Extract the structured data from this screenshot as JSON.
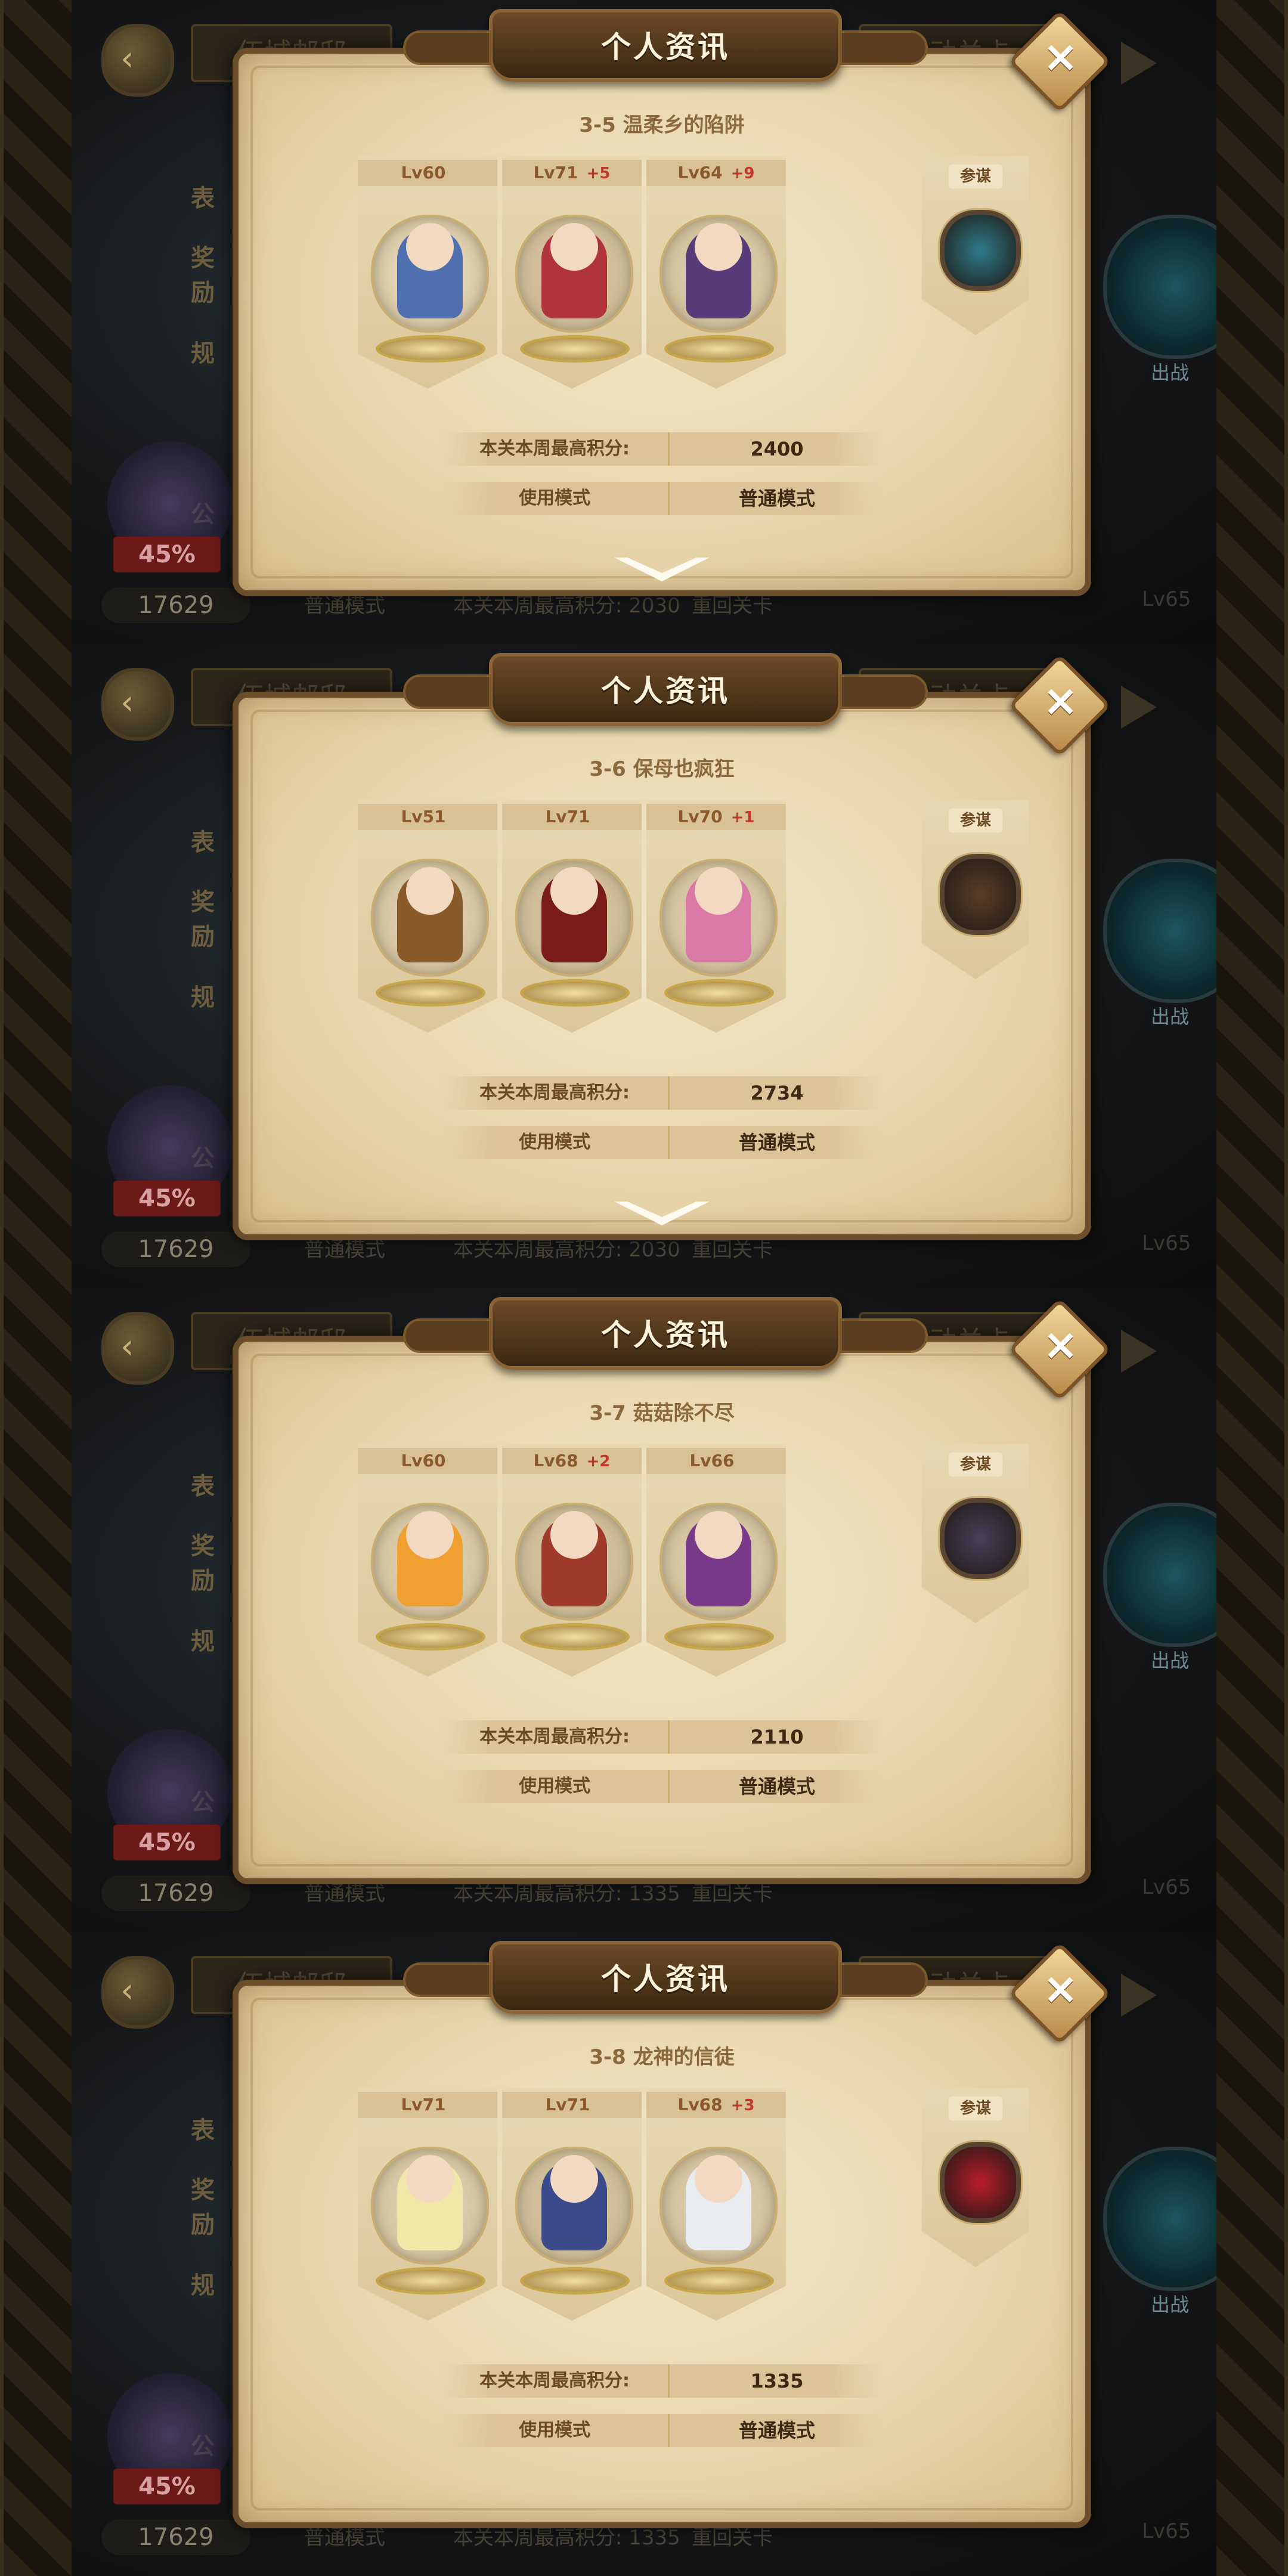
{
  "dialog_title": "个人资讯",
  "close_icon": "×",
  "background": {
    "back_icon": "‹",
    "tab_left": "伍城邮邸",
    "tab_right": "活动关卡",
    "side_items": [
      "表",
      "奖励",
      "规",
      "公"
    ],
    "percent": "45%",
    "player_score": "17629",
    "mode_text": "普通模式",
    "next_button": "重回关卡",
    "sortie_label": "出战",
    "level_hint": "Lv65"
  },
  "stat_labels": {
    "best_score": "本关本周最高积分:",
    "mode": "使用模式",
    "helper": "参谋"
  },
  "panels": [
    {
      "stage": "3-5 温柔乡的陷阱",
      "bg_score_line": "本关本周最高积分: 2030",
      "heroes": [
        {
          "lv": "Lv60",
          "plus": ""
        },
        {
          "lv": "Lv71",
          "plus": "+5"
        },
        {
          "lv": "Lv64",
          "plus": "+9"
        }
      ],
      "score": "2400",
      "mode": "普通模式",
      "show_arrow": true
    },
    {
      "stage": "3-6 保母也疯狂",
      "bg_score_line": "本关本周最高积分: 2030",
      "heroes": [
        {
          "lv": "Lv51",
          "plus": ""
        },
        {
          "lv": "Lv71",
          "plus": ""
        },
        {
          "lv": "Lv70",
          "plus": "+1"
        }
      ],
      "score": "2734",
      "mode": "普通模式",
      "show_arrow": true
    },
    {
      "stage": "3-7 菇菇除不尽",
      "bg_score_line": "本关本周最高积分: 1335",
      "heroes": [
        {
          "lv": "Lv60",
          "plus": ""
        },
        {
          "lv": "Lv68",
          "plus": "+2"
        },
        {
          "lv": "Lv66",
          "plus": ""
        }
      ],
      "score": "2110",
      "mode": "普通模式",
      "show_arrow": false
    },
    {
      "stage": "3-8 龙神的信徒",
      "bg_score_line": "本关本周最高积分: 1335",
      "heroes": [
        {
          "lv": "Lv71",
          "plus": ""
        },
        {
          "lv": "Lv71",
          "plus": ""
        },
        {
          "lv": "Lv68",
          "plus": "+3"
        }
      ],
      "score": "1335",
      "mode": "普通模式",
      "show_arrow": false
    }
  ],
  "colors": {
    "parchment": "#efe0bb",
    "frame": "#6a4e2b",
    "title_text": "#fff4de",
    "plus_red": "#c0392b",
    "portrait_palettes": [
      [
        "#f5ead3",
        "#4f6fb0"
      ],
      [
        "#d9c8a6",
        "#b0333e"
      ],
      [
        "#e6d6b9",
        "#5a3b7a"
      ],
      [
        "#eadcc0",
        "#8a5b2a"
      ],
      [
        "#d9c8a6",
        "#7a1c1c"
      ],
      [
        "#e6d6b9",
        "#d97aa6"
      ],
      [
        "#eadcc0",
        "#f0a030"
      ],
      [
        "#d9c8a6",
        "#a03a2a"
      ],
      [
        "#e6d6b9",
        "#7a3a8a"
      ],
      [
        "#eadcc0",
        "#f2e6a8"
      ],
      [
        "#d9c8a6",
        "#3b4a8a"
      ],
      [
        "#e6d6b9",
        "#e9ecef"
      ]
    ],
    "helper_palettes": [
      "#2f7a8a",
      "#5b3d25",
      "#4a3f5a",
      "#b81c2a"
    ]
  }
}
